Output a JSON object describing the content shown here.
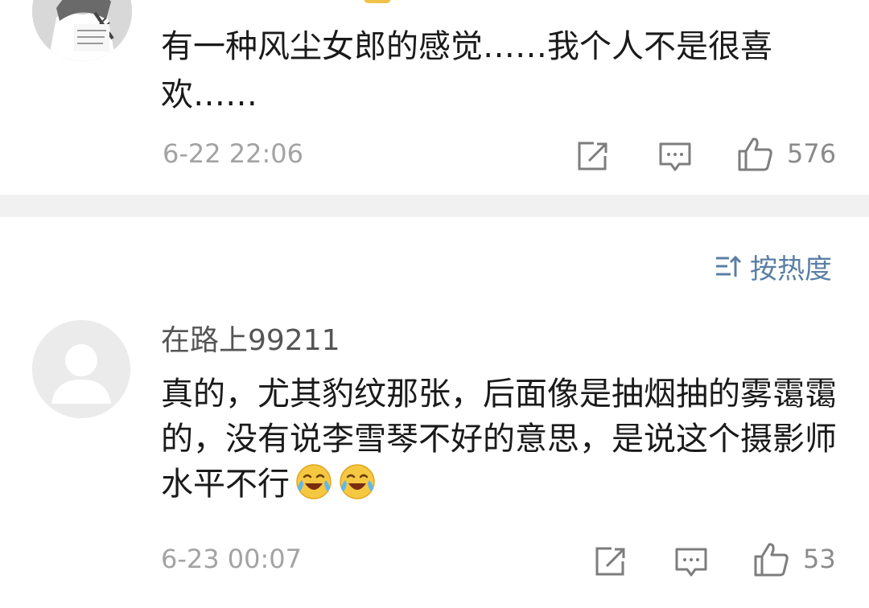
{
  "comment1": {
    "username": "",
    "text": "有一种风尘女郎的感觉……我个人不是很喜欢……",
    "time": "6-22 22:06",
    "likes": "576"
  },
  "sort": {
    "label": "按热度",
    "icon": "sort-icon"
  },
  "comment2": {
    "username": "在路上99211",
    "text": "真的，尤其豹纹那张，后面像是抽烟抽的雾霭霭的，没有说李雪琴不好的意思，是说这个摄影师水平不行",
    "emojis": [
      "laugh-cry-emoji",
      "laugh-cry-emoji"
    ],
    "time": "6-23 00:07",
    "likes": "53"
  },
  "icons": {
    "share": "share-icon",
    "comment": "comment-icon",
    "like": "thumbs-up-icon"
  },
  "colors": {
    "link_blue": "#5b7fa6",
    "meta_gray": "#a3a3a3",
    "separator": "#f1f1f1"
  }
}
